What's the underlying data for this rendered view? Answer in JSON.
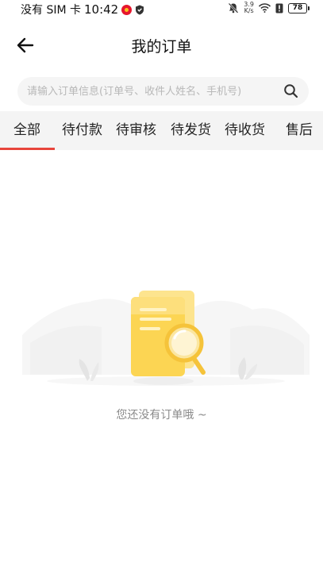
{
  "status_bar": {
    "carrier": "没有 SIM 卡",
    "time": "10:42",
    "net_speed_value": "3.9",
    "net_speed_unit": "K/s",
    "battery": "78"
  },
  "header": {
    "title": "我的订单"
  },
  "search": {
    "placeholder": "请输入订单信息(订单号、收件人姓名、手机号)",
    "value": ""
  },
  "tabs": [
    {
      "label": "全部",
      "active": true
    },
    {
      "label": "待付款",
      "active": false
    },
    {
      "label": "待审核",
      "active": false
    },
    {
      "label": "待发货",
      "active": false
    },
    {
      "label": "待收货",
      "active": false
    },
    {
      "label": "售后",
      "active": false
    }
  ],
  "empty_state": {
    "message": "您还没有订单哦 ~"
  },
  "colors": {
    "accent": "#e8453c",
    "tab_bar_bg": "#f4f4f4",
    "illustration_yellow": "#fcd553"
  },
  "icons": {
    "back": "arrow-left-icon",
    "search": "search-icon",
    "empty": "document-magnifier-illustration"
  }
}
